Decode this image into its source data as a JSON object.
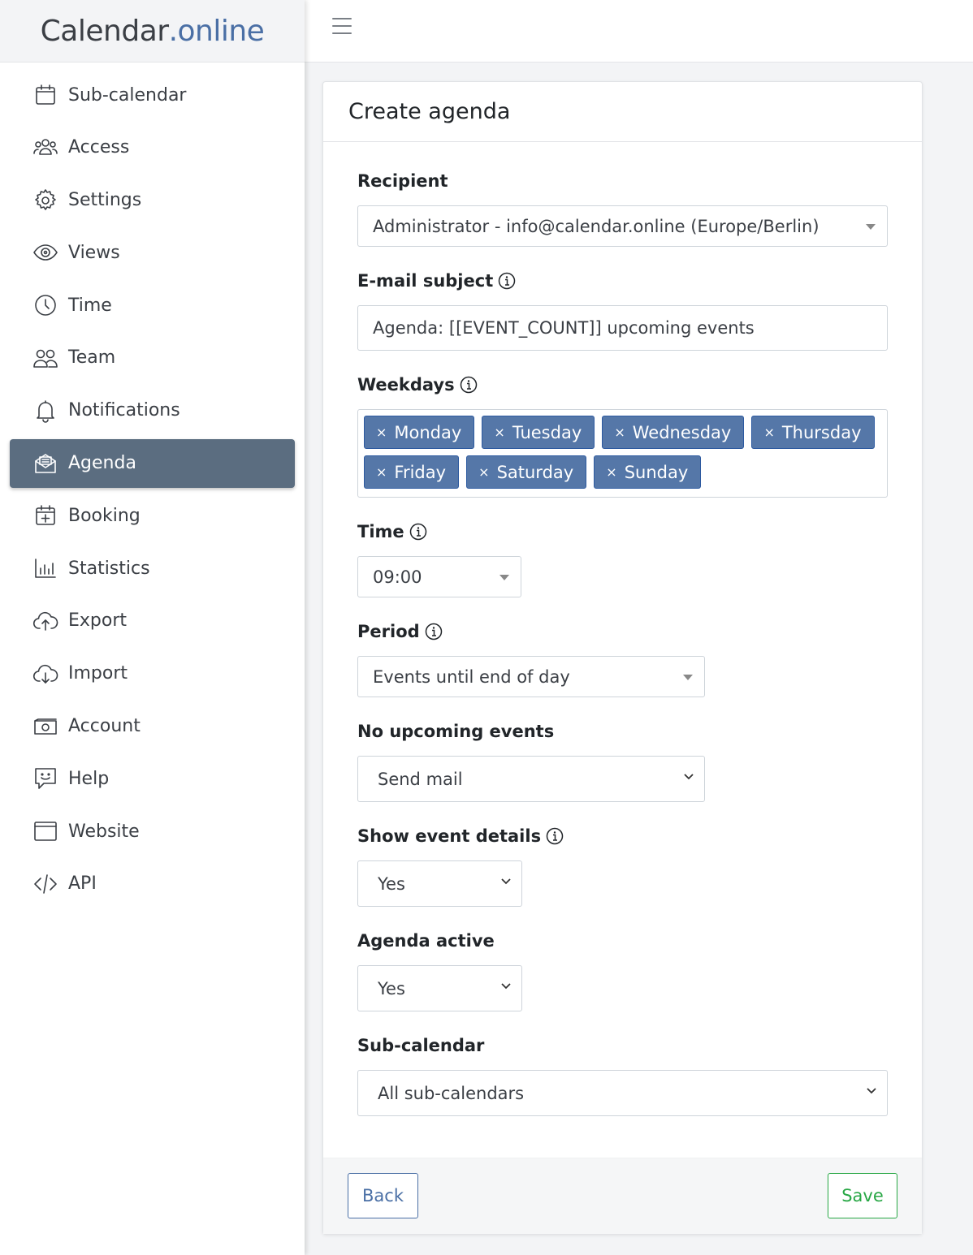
{
  "brand": {
    "part1": "Calendar",
    "part2": ".online"
  },
  "colors": {
    "accent": "#4a6fa5",
    "active_nav": "#5b6d80",
    "tag": "#5577a8",
    "save": "#28a745"
  },
  "sidebar": {
    "items": [
      {
        "label": "Sub-calendar",
        "icon": "calendar-icon"
      },
      {
        "label": "Access",
        "icon": "users-icon"
      },
      {
        "label": "Settings",
        "icon": "gear-icon"
      },
      {
        "label": "Views",
        "icon": "eye-icon"
      },
      {
        "label": "Time",
        "icon": "clock-icon"
      },
      {
        "label": "Team",
        "icon": "team-icon"
      },
      {
        "label": "Notifications",
        "icon": "bell-icon"
      },
      {
        "label": "Agenda",
        "icon": "envelope-open-icon",
        "active": true
      },
      {
        "label": "Booking",
        "icon": "calendar-plus-icon"
      },
      {
        "label": "Statistics",
        "icon": "bar-chart-icon"
      },
      {
        "label": "Export",
        "icon": "cloud-upload-icon"
      },
      {
        "label": "Import",
        "icon": "cloud-download-icon"
      },
      {
        "label": "Account",
        "icon": "money-icon"
      },
      {
        "label": "Help",
        "icon": "chat-smile-icon"
      },
      {
        "label": "Website",
        "icon": "browser-window-icon"
      },
      {
        "label": "API",
        "icon": "code-icon"
      }
    ]
  },
  "form": {
    "title": "Create agenda",
    "recipient_label": "Recipient",
    "recipient_value": "Administrator - info@calendar.online (Europe/Berlin)",
    "subject_label": "E-mail subject",
    "subject_value": "Agenda: [[EVENT_COUNT]] upcoming events",
    "weekdays_label": "Weekdays",
    "weekdays": [
      "Monday",
      "Tuesday",
      "Wednesday",
      "Thursday",
      "Friday",
      "Saturday",
      "Sunday"
    ],
    "tag_remove": "×",
    "time_label": "Time",
    "time_value": "09:00",
    "period_label": "Period",
    "period_value": "Events until end of day",
    "no_events_label": "No upcoming events",
    "no_events_value": "Send mail",
    "details_label": "Show event details",
    "details_value": "Yes",
    "active_label": "Agenda active",
    "active_value": "Yes",
    "subcal_label": "Sub-calendar",
    "subcal_value": "All sub-calendars",
    "back_label": "Back",
    "save_label": "Save"
  }
}
